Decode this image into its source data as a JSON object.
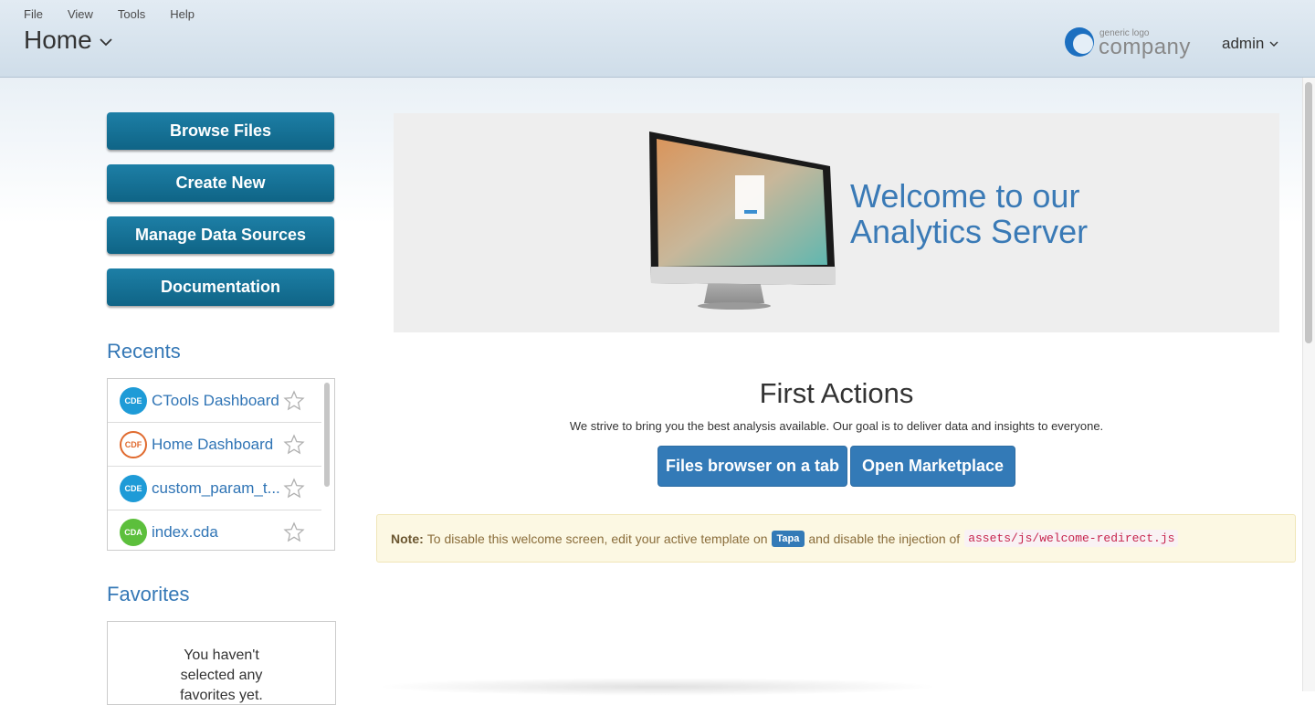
{
  "menu": [
    "File",
    "View",
    "Tools",
    "Help"
  ],
  "header": {
    "title": "Home",
    "logo_small": "generic logo",
    "logo_big": "company",
    "user": "admin"
  },
  "sidebar": {
    "buttons": [
      "Browse Files",
      "Create New",
      "Manage Data Sources",
      "Documentation"
    ],
    "recents_title": "Recents",
    "recents": [
      {
        "badge": "CDE",
        "label": "CTools Dashboard"
      },
      {
        "badge": "CDF",
        "label": "Home Dashboard"
      },
      {
        "badge": "CDE",
        "label": "custom_param_t..."
      },
      {
        "badge": "CDA",
        "label": "index.cda"
      }
    ],
    "favorites_title": "Favorites",
    "favorites_empty": "You haven't selected any favorites yet. Add"
  },
  "hero": {
    "line1": "Welcome to our",
    "line2": "Analytics Server"
  },
  "actions": {
    "title": "First Actions",
    "tagline": "We strive to bring you the best analysis available. Our goal is to deliver data and insights to everyone.",
    "btn_files": "Files browser on a tab",
    "btn_marketplace": "Open Marketplace"
  },
  "note": {
    "label": "Note:",
    "text1": "To disable this welcome screen, edit your active template on",
    "tag": "Tapa",
    "text2": "and disable the injection of",
    "code": "assets/js/welcome-redirect.js"
  },
  "colors": {
    "sidebar_button": "#1a7aa0",
    "link": "#2f74b5",
    "primary": "#337ab7"
  }
}
